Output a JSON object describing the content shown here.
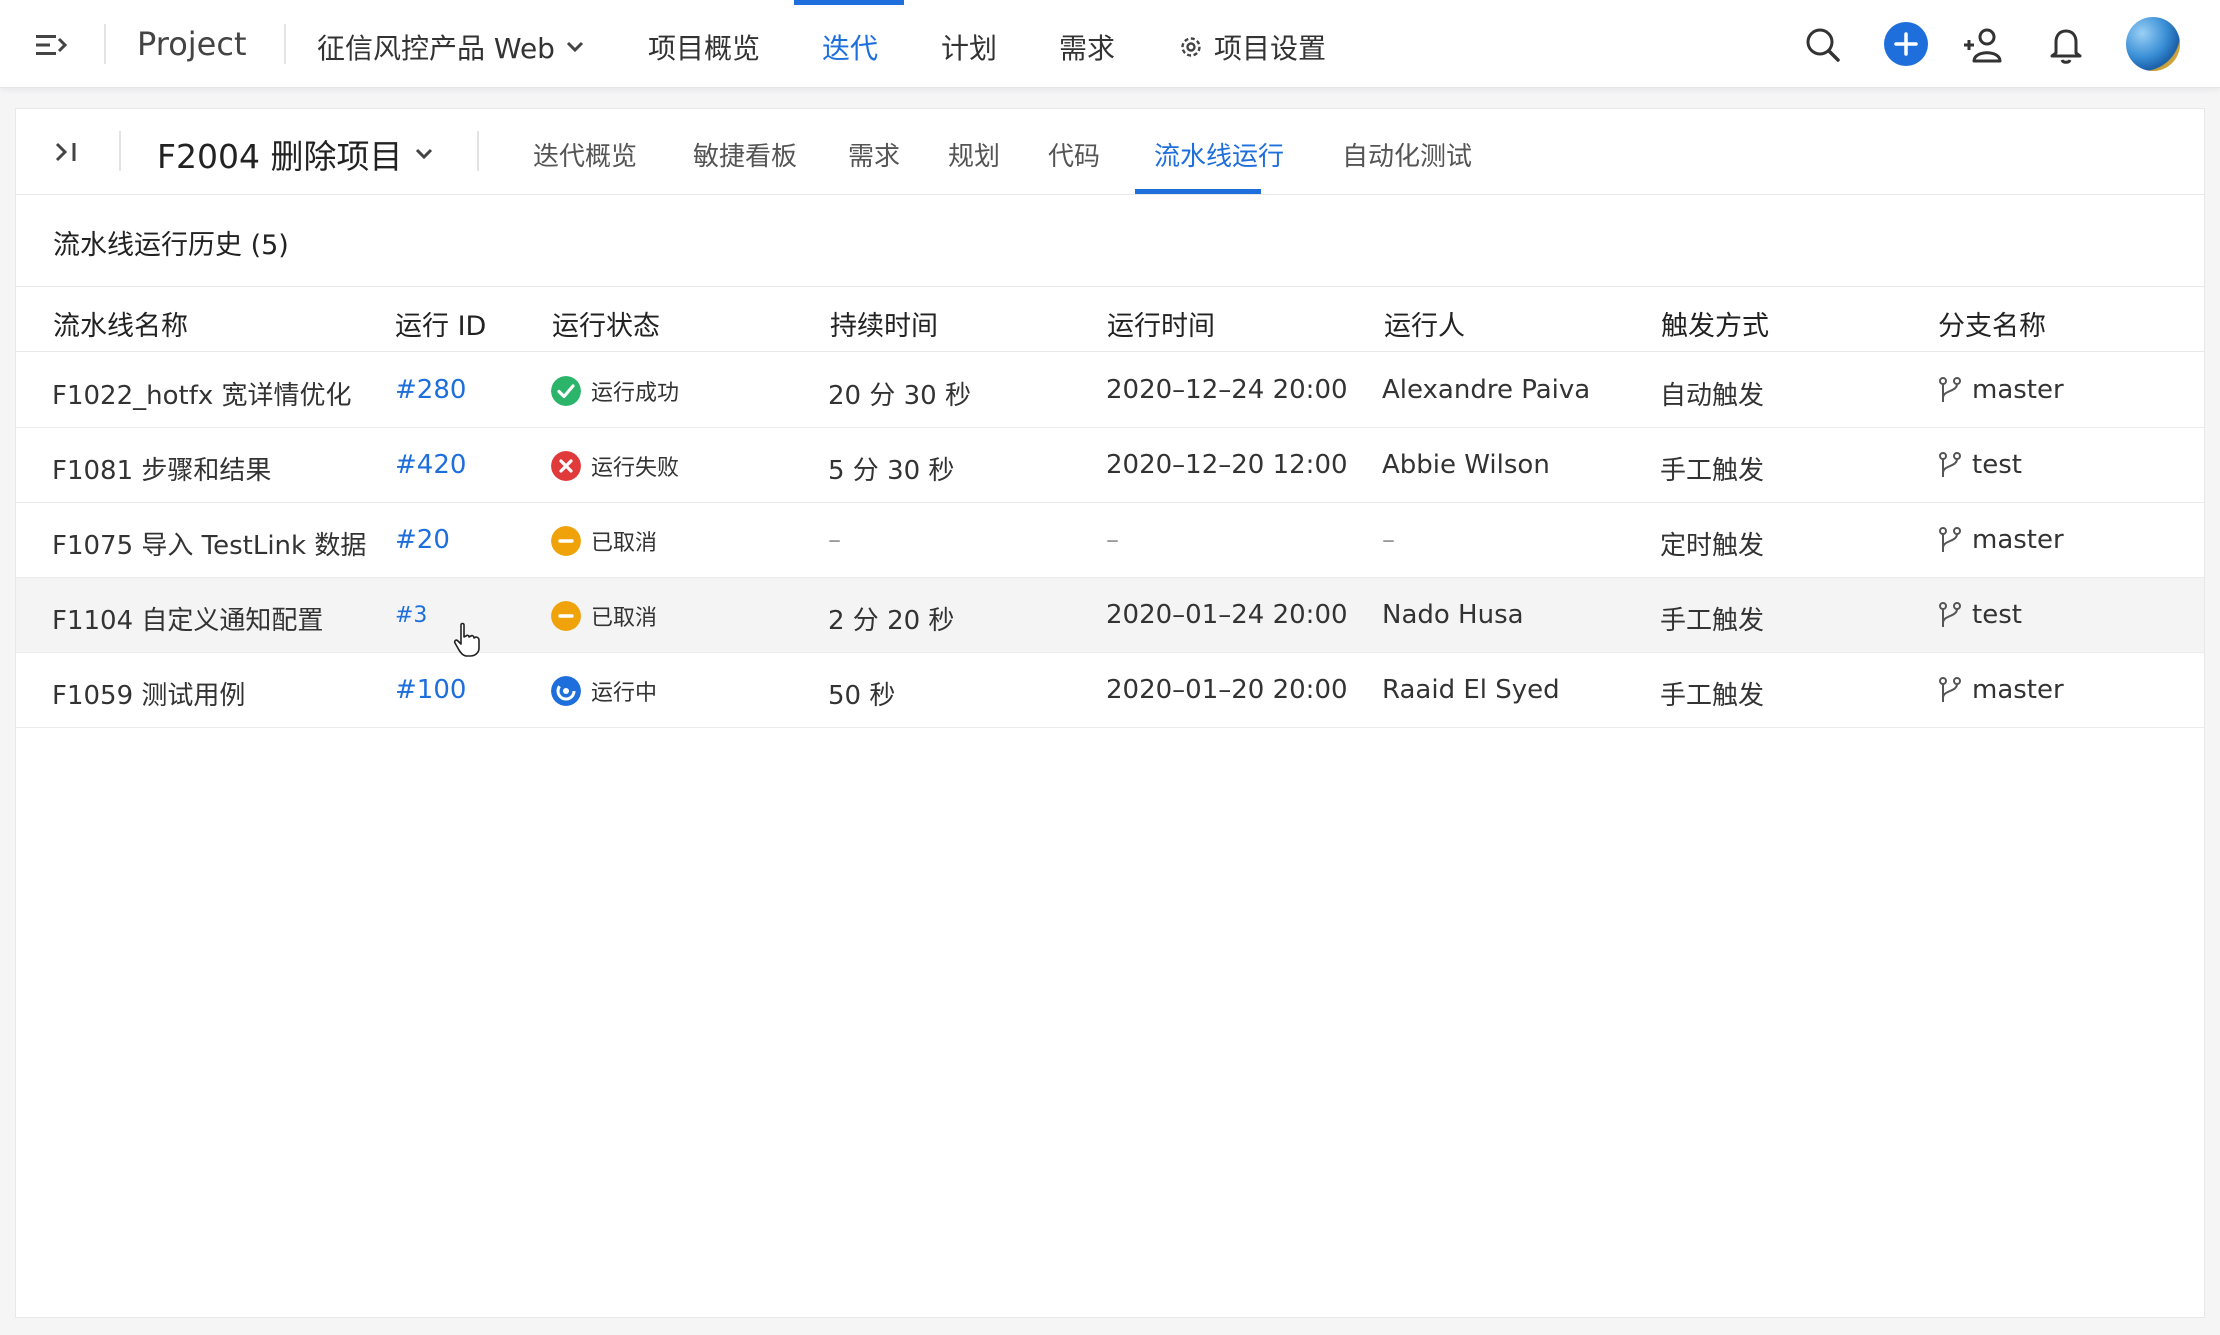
{
  "topbar": {
    "project_label": "Project",
    "product_selector": "征信风控产品 Web",
    "nav": [
      {
        "label": "项目概览",
        "active": false
      },
      {
        "label": "迭代",
        "active": true
      },
      {
        "label": "计划",
        "active": false
      },
      {
        "label": "需求",
        "active": false
      }
    ],
    "settings_label": "项目设置",
    "icons": [
      "menu-icon",
      "search-icon",
      "plus-icon",
      "add-member-icon",
      "bell-icon",
      "avatar"
    ],
    "accent_color": "#1e6fdc"
  },
  "iteration": {
    "title": "F2004 删除项目",
    "tabs": [
      {
        "label": "迭代概览",
        "active": false
      },
      {
        "label": "敏捷看板",
        "active": false
      },
      {
        "label": "需求",
        "active": false
      },
      {
        "label": "规划",
        "active": false
      },
      {
        "label": "代码",
        "active": false
      },
      {
        "label": "流水线运行",
        "active": true
      },
      {
        "label": "自动化测试",
        "active": false
      }
    ]
  },
  "history": {
    "title": "流水线运行历史 (5)",
    "columns": [
      "流水线名称",
      "运行 ID",
      "运行状态",
      "持续时间",
      "运行时间",
      "运行人",
      "触发方式",
      "分支名称"
    ],
    "rows": [
      {
        "name": "F1022_hotfx 宽详情优化",
        "run_id": "#280",
        "status": "运行成功",
        "status_type": "success",
        "duration": "20 分 30 秒",
        "run_time": "2020–12–24 20:00",
        "runner": "Alexandre Paiva",
        "trigger": "自动触发",
        "branch": "master"
      },
      {
        "name": "F1081 步骤和结果",
        "run_id": "#420",
        "status": "运行失败",
        "status_type": "failed",
        "duration": "5 分 30 秒",
        "run_time": "2020–12–20 12:00",
        "runner": "Abbie Wilson",
        "trigger": "手工触发",
        "branch": "test"
      },
      {
        "name": "F1075 导入 TestLink 数据",
        "run_id": "#20",
        "status": "已取消",
        "status_type": "cancelled",
        "duration": "–",
        "run_time": "–",
        "runner": "–",
        "trigger": "定时触发",
        "branch": "master"
      },
      {
        "name": "F1104 自定义通知配置",
        "run_id": "#3",
        "status": "已取消",
        "status_type": "cancelled",
        "duration": "2 分 20 秒",
        "run_time": "2020–01–24 20:00",
        "runner": "Nado Husa",
        "trigger": "手工触发",
        "branch": "test"
      },
      {
        "name": "F1059 测试用例",
        "run_id": "#100",
        "status": "运行中",
        "status_type": "running",
        "duration": "50 秒",
        "run_time": "2020–01–20 20:00",
        "runner": "Raaid El Syed",
        "trigger": "手工触发",
        "branch": "master"
      }
    ],
    "status_colors": {
      "success": "#2cb56a",
      "failed": "#e03a3a",
      "cancelled": "#f0a20a",
      "running": "#1e6fdc"
    }
  }
}
